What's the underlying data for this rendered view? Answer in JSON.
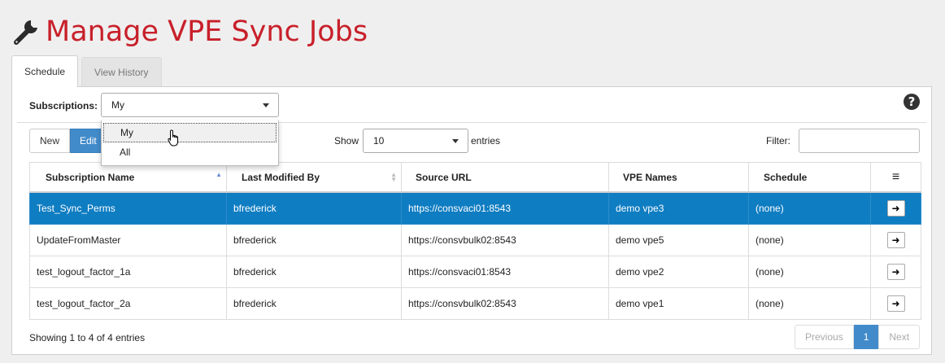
{
  "page": {
    "title": "Manage VPE Sync Jobs",
    "icon": "wrench-icon",
    "title_color": "#c8202a"
  },
  "tabs": [
    {
      "label": "Schedule",
      "active": true
    },
    {
      "label": "View History",
      "active": false
    }
  ],
  "subscriptions": {
    "label": "Subscriptions:",
    "selected": "My",
    "options": [
      "My",
      "All"
    ],
    "hovered_option": "My"
  },
  "toolbar": {
    "new_label": "New",
    "edit_label": "Edit",
    "show_label": "Show",
    "page_size": "10",
    "entries_label": "entries",
    "filter_label": "Filter:",
    "filter_value": ""
  },
  "table": {
    "columns": [
      "Subscription Name",
      "Last Modified By",
      "Source URL",
      "VPE Names",
      "Schedule"
    ],
    "menu_icon": "≡",
    "rows": [
      {
        "name": "Test_Sync_Perms",
        "modified_by": "bfrederick",
        "url": "https://consvaci01:8543",
        "vpe": "demo vpe3",
        "schedule": "(none)",
        "selected": true
      },
      {
        "name": "UpdateFromMaster",
        "modified_by": "bfrederick",
        "url": "https://consvbulk02:8543",
        "vpe": "demo vpe5",
        "schedule": "(none)",
        "selected": false
      },
      {
        "name": "test_logout_factor_1a",
        "modified_by": "bfrederick",
        "url": "https://consvaci01:8543",
        "vpe": "demo vpe2",
        "schedule": "(none)",
        "selected": false
      },
      {
        "name": "test_logout_factor_2a",
        "modified_by": "bfrederick",
        "url": "https://consvbulk02:8543",
        "vpe": "demo vpe1",
        "schedule": "(none)",
        "selected": false
      }
    ]
  },
  "footer": {
    "showing": "Showing 1 to 4 of 4 entries",
    "previous": "Previous",
    "current_page": "1",
    "next": "Next"
  },
  "colors": {
    "accent": "#428bca",
    "selected_row": "#0f7dc2"
  }
}
